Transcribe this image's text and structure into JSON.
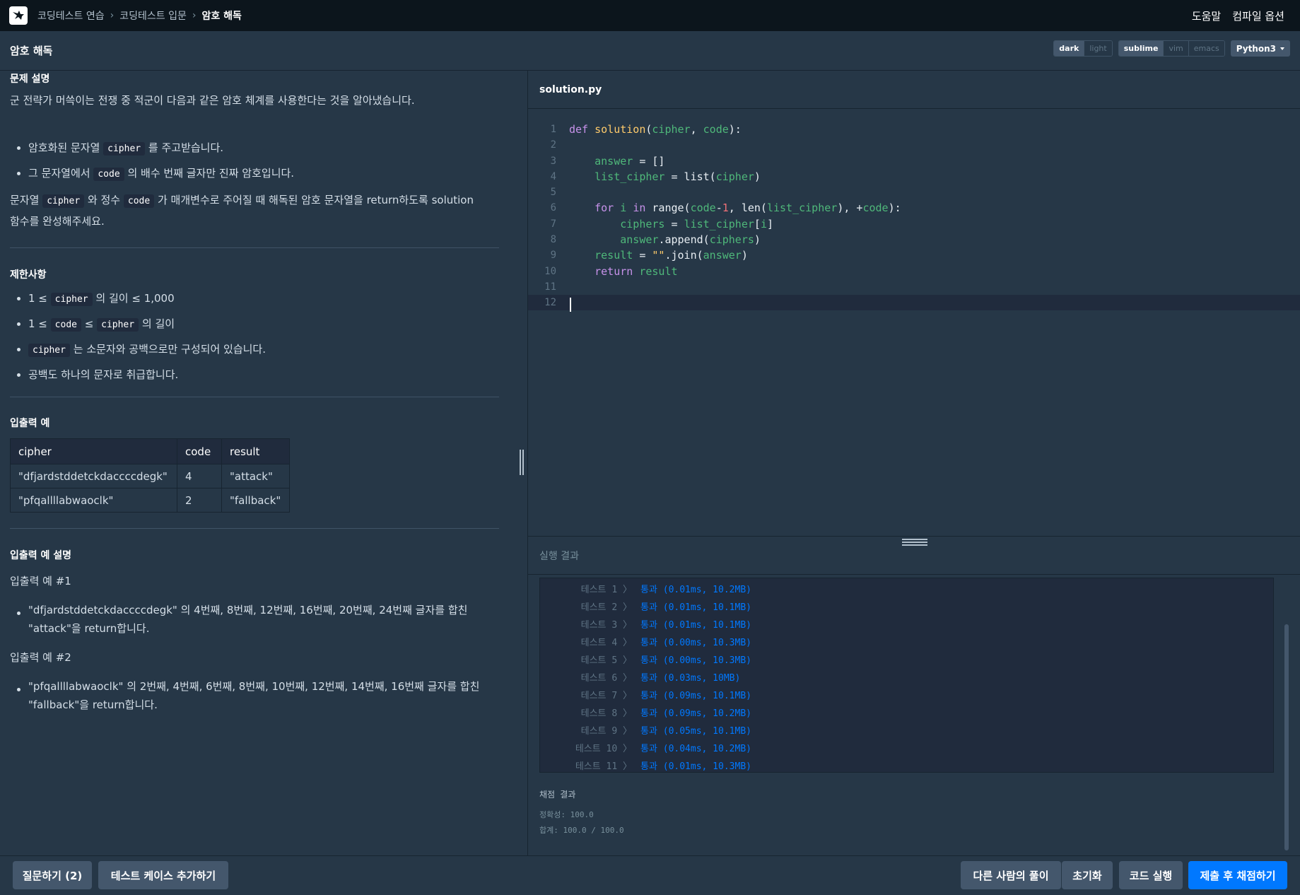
{
  "nav": {
    "breadcrumbs": [
      "코딩테스트 연습",
      "코딩테스트 입문",
      "암호 해독"
    ],
    "help": "도움말",
    "compile_options": "컴파일 옵션"
  },
  "titlebar": {
    "title": "암호 해독",
    "theme_options": [
      "dark",
      "light"
    ],
    "theme_selected": "dark",
    "keymap_options": [
      "sublime",
      "vim",
      "emacs"
    ],
    "keymap_selected": "sublime",
    "language": "Python3"
  },
  "problem": {
    "desc_heading": "문제 설명",
    "desc_intro": "군 전략가 머쓱이는 전쟁 중 적군이 다음과 같은 암호 체계를 사용한다는 것을 알아냈습니다.",
    "bullet1_pre": "암호화된 문자열",
    "bullet1_code": "cipher",
    "bullet1_post": "를 주고받습니다.",
    "bullet2_pre": "그 문자열에서",
    "bullet2_code": "code",
    "bullet2_post": "의 배수 번째 글자만 진짜 암호입니다.",
    "task_1": "문자열",
    "task_code1": "cipher",
    "task_2": "와 정수",
    "task_code2": "code",
    "task_3": "가 매개변수로 주어질 때 해독된 암호 문자열을 return하도록 solution",
    "task_4": "함수를 완성해주세요.",
    "constraints_heading": "제한사항",
    "c1_pre": "1 ≤",
    "c1_code": "cipher",
    "c1_post": "의 길이 ≤ 1,000",
    "c2_pre": "1 ≤",
    "c2_code1": "code",
    "c2_mid": "≤",
    "c2_code2": "cipher",
    "c2_post": "의 길이",
    "c3_code": "cipher",
    "c3_post": "는 소문자와 공백으로만 구성되어 있습니다.",
    "c4": "공백도 하나의 문자로 취급합니다.",
    "examples_heading": "입출력 예",
    "table": {
      "headers": [
        "cipher",
        "code",
        "result"
      ],
      "rows": [
        [
          "\"dfjardstddetckdaccccdegk\"",
          "4",
          "\"attack\""
        ],
        [
          "\"pfqallllabwaoclk\"",
          "2",
          "\"fallback\""
        ]
      ]
    },
    "explain_heading": "입출력 예 설명",
    "ex1_title": "입출력 예 #1",
    "ex1_line1": "\"dfjardstddetckdaccccdegk\" 의 4번째, 8번째, 12번째, 16번째, 20번째, 24번째 글자를 합친",
    "ex1_line2": "\"attack\"을 return합니다.",
    "ex2_title": "입출력 예 #2",
    "ex2_line1": "\"pfqallllabwaoclk\" 의 2번째, 4번째, 6번째, 8번째, 10번째, 12번째, 14번째, 16번째 글자를 합친",
    "ex2_line2": "\"fallback\"을 return합니다."
  },
  "editor": {
    "filename": "solution.py",
    "line_numbers": [
      "1",
      "2",
      "3",
      "4",
      "5",
      "6",
      "7",
      "8",
      "9",
      "10",
      "11",
      "12"
    ]
  },
  "results": {
    "title": "실행 결과",
    "tests": [
      {
        "name": "테스트 1 〉",
        "result": "통과 (0.01ms, 10.2MB)"
      },
      {
        "name": "테스트 2 〉",
        "result": "통과 (0.01ms, 10.1MB)"
      },
      {
        "name": "테스트 3 〉",
        "result": "통과 (0.01ms, 10.1MB)"
      },
      {
        "name": "테스트 4 〉",
        "result": "통과 (0.00ms, 10.3MB)"
      },
      {
        "name": "테스트 5 〉",
        "result": "통과 (0.00ms, 10.3MB)"
      },
      {
        "name": "테스트 6 〉",
        "result": "통과 (0.03ms, 10MB)"
      },
      {
        "name": "테스트 7 〉",
        "result": "통과 (0.09ms, 10.1MB)"
      },
      {
        "name": "테스트 8 〉",
        "result": "통과 (0.09ms, 10.2MB)"
      },
      {
        "name": "테스트 9 〉",
        "result": "통과 (0.05ms, 10.1MB)"
      },
      {
        "name": "테스트 10 〉",
        "result": "통과 (0.04ms, 10.2MB)"
      },
      {
        "name": "테스트 11 〉",
        "result": "통과 (0.01ms, 10.3MB)"
      }
    ],
    "grading_title": "채점 결과",
    "accuracy": "정확성: 100.0",
    "total": "합계: 100.0 / 100.0"
  },
  "bottom": {
    "ask": "질문하기 (2)",
    "add_testcase": "테스트 케이스 추가하기",
    "others_solutions": "다른 사람의 풀이",
    "reset": "초기화",
    "run": "코드 실행",
    "submit": "제출 후 채점하기"
  },
  "colors": {
    "background": "#263747",
    "topbar": "#0c151c",
    "accent": "#0078ff",
    "pass_text": "#0078ff"
  }
}
